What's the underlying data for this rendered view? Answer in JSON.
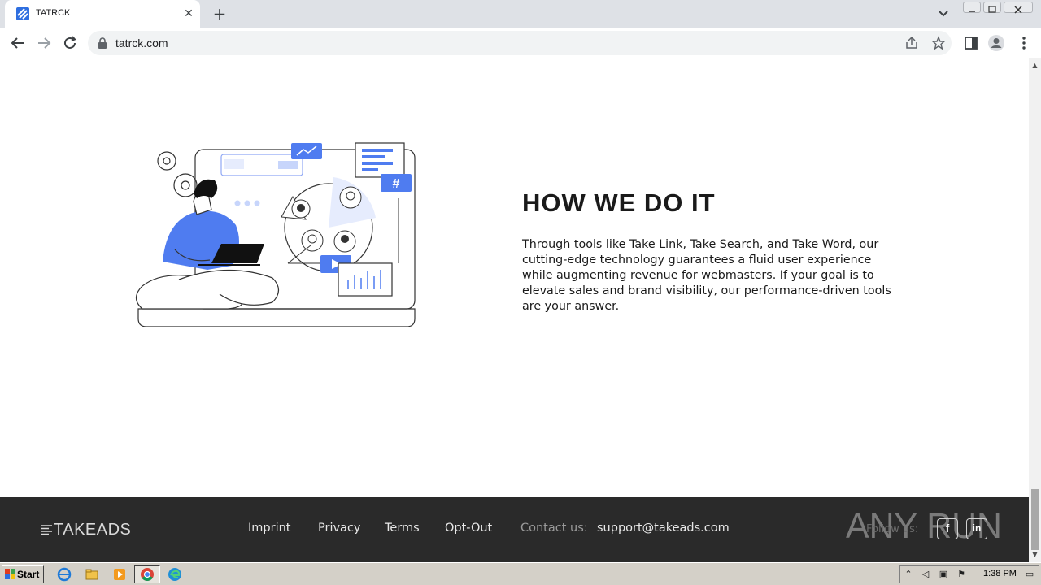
{
  "browser": {
    "tab_title": "TATRCK",
    "tab_close": "✕",
    "new_tab": "+",
    "url": "tatrck.com"
  },
  "page": {
    "hero": {
      "title": "HOW WE DO IT",
      "body": "Through tools like Take Link, Take Search, and Take Word, our cutting-edge technology guarantees a fluid user experience while augmenting revenue for webmasters. If your goal is to elevate sales and brand visibility, our performance-driven tools are your answer.",
      "illustration_hash": "#"
    },
    "footer": {
      "brand": "TAKEADS",
      "links": [
        "Imprint",
        "Privacy",
        "Terms",
        "Opt-Out"
      ],
      "contact_label": "Contact us:",
      "contact_email": "support@takeads.com",
      "follow_label": "Follow us:",
      "social": [
        {
          "name": "facebook-icon",
          "glyph": "f"
        },
        {
          "name": "linkedin-icon",
          "glyph": "in"
        }
      ],
      "watermark": "ANY RUN"
    }
  },
  "taskbar": {
    "start_label": "Start",
    "clock": "1:38 PM"
  },
  "colors": {
    "accent_blue": "#4f7cf0",
    "footer_bg": "#2a2a2a"
  }
}
